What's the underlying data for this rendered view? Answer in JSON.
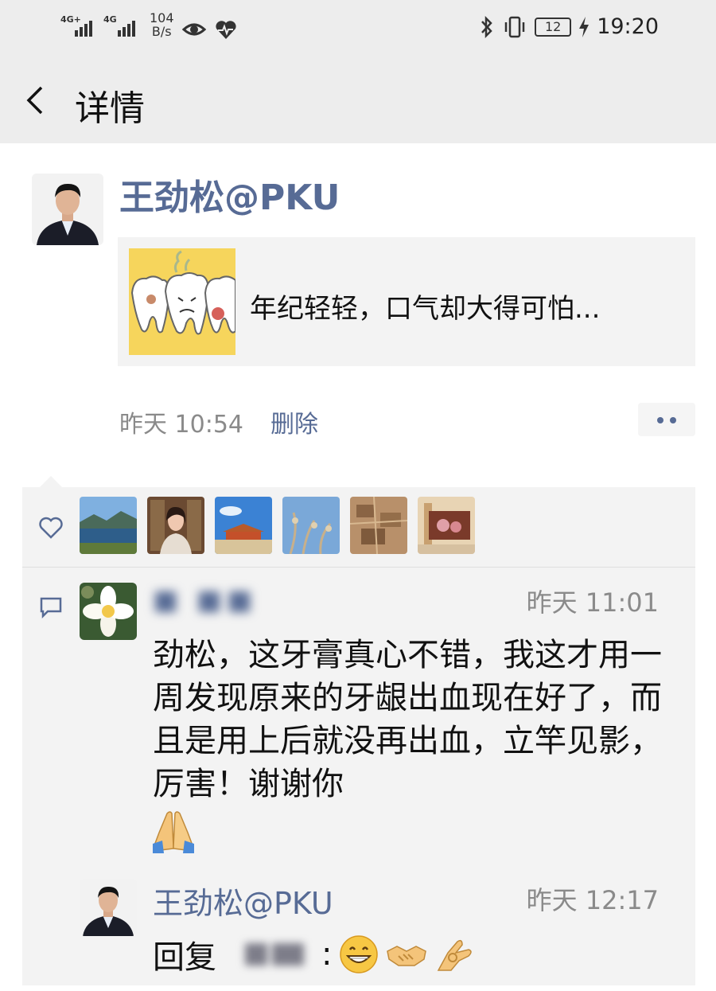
{
  "status_bar": {
    "network_1": "4G+",
    "network_2": "4G",
    "speed_value": "104",
    "speed_unit": "B/s",
    "battery": "12",
    "time": "19:20"
  },
  "nav": {
    "title": "详情"
  },
  "post": {
    "author": "王劲松@PKU",
    "link_text": "年纪轻轻，口气却大得可怕...",
    "time": "昨天 10:54",
    "delete_label": "删除"
  },
  "comments": [
    {
      "author": "■ ■■",
      "time": "昨天 11:01",
      "text": "劲松，这牙膏真心不错，我这才用一周发现原来的牙龈出血现在好了，而且是用上后就没再出血，立竿见影，厉害！谢谢你"
    },
    {
      "author": "王劲松@PKU",
      "time": "昨天 12:17",
      "reply_prefix": "回复",
      "reply_colon": ":"
    }
  ],
  "colors": {
    "link_blue": "#576b95",
    "header_gray": "#ededed",
    "panel_gray": "#f3f3f3"
  }
}
